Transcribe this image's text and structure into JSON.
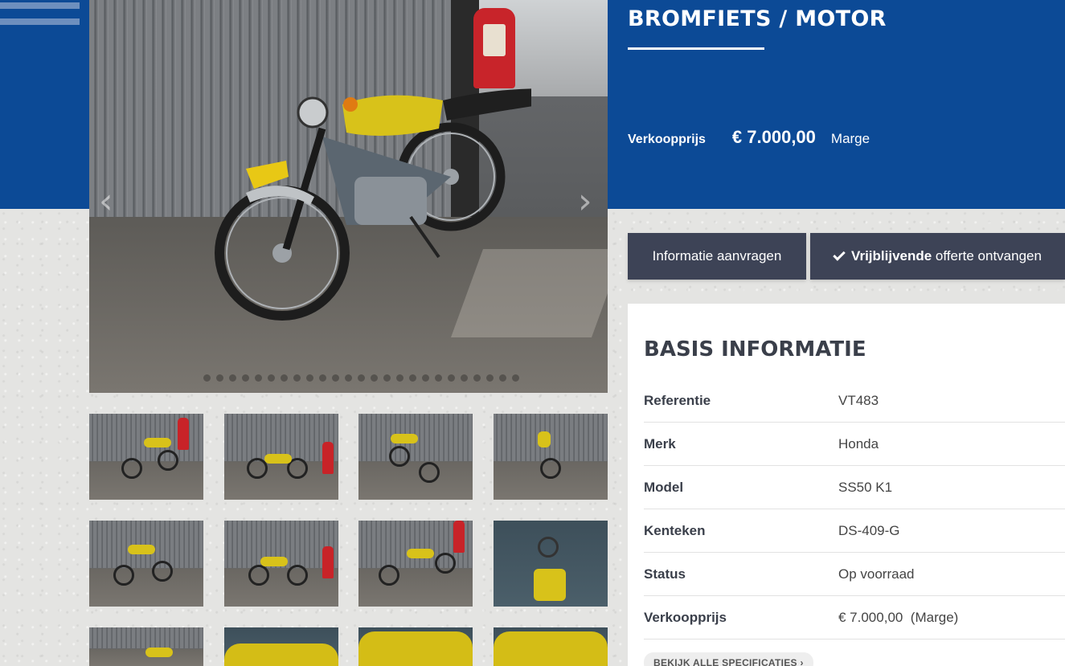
{
  "header": {
    "title": "BROMFIETS / MOTOR"
  },
  "price": {
    "label": "Verkoopprijs",
    "value": "€ 7.000,00",
    "extra": "Marge"
  },
  "buttons": {
    "info": "Informatie aanvragen",
    "offer_bold": "Vrijblijvende",
    "offer_rest": " offerte ontvangen"
  },
  "gallery": {
    "prev_arrow": "‹",
    "next_arrow": "›",
    "dot_count": 25
  },
  "basis": {
    "title": "BASIS INFORMATIE",
    "rows": [
      {
        "label": "Referentie",
        "value": "VT483"
      },
      {
        "label": "Merk",
        "value": "Honda"
      },
      {
        "label": "Model",
        "value": "SS50 K1"
      },
      {
        "label": "Kenteken",
        "value": "DS-409-G"
      },
      {
        "label": "Status",
        "value": "Op voorraad"
      },
      {
        "label": "Verkoopprijs",
        "value": "€ 7.000,00  (Marge)"
      }
    ],
    "all_specs_link": "BEKIJK ALLE SPECIFICATIES ›"
  },
  "colors": {
    "brand_blue": "#0c4a96",
    "button_dark": "#3d4356",
    "tank_yellow": "#d8c21a"
  }
}
